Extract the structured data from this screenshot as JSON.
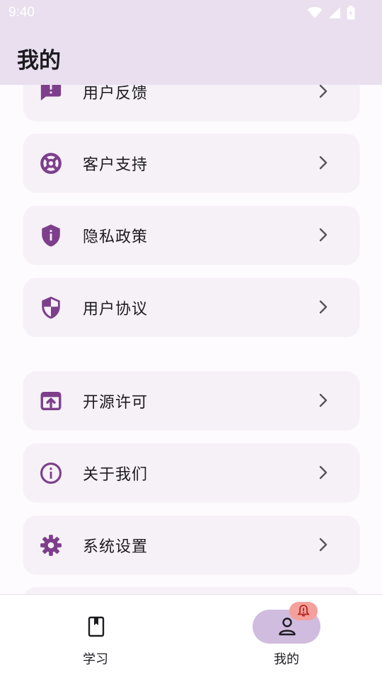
{
  "status_bar": {
    "time": "9:40"
  },
  "header": {
    "title": "我的"
  },
  "menu": {
    "items": [
      {
        "label": "用户反馈",
        "icon": "feedback-icon"
      },
      {
        "label": "客户支持",
        "icon": "support-lifebuoy-icon"
      },
      {
        "label": "隐私政策",
        "icon": "privacy-shield-icon"
      },
      {
        "label": "用户协议",
        "icon": "agreement-shield-icon"
      },
      {
        "label": "开源许可",
        "icon": "open-source-icon"
      },
      {
        "label": "关于我们",
        "icon": "info-icon"
      },
      {
        "label": "系统设置",
        "icon": "settings-gear-icon"
      }
    ]
  },
  "bottom_nav": {
    "items": [
      {
        "label": "学习",
        "icon": "book-icon",
        "active": false
      },
      {
        "label": "我的",
        "icon": "person-icon",
        "active": true
      }
    ]
  },
  "colors": {
    "accent": "#7d3f8c",
    "app_bar": "#e9dfee",
    "card": "#f6f1f7",
    "active_indicator": "#d0bcdf",
    "badge": "#f4a09c"
  }
}
